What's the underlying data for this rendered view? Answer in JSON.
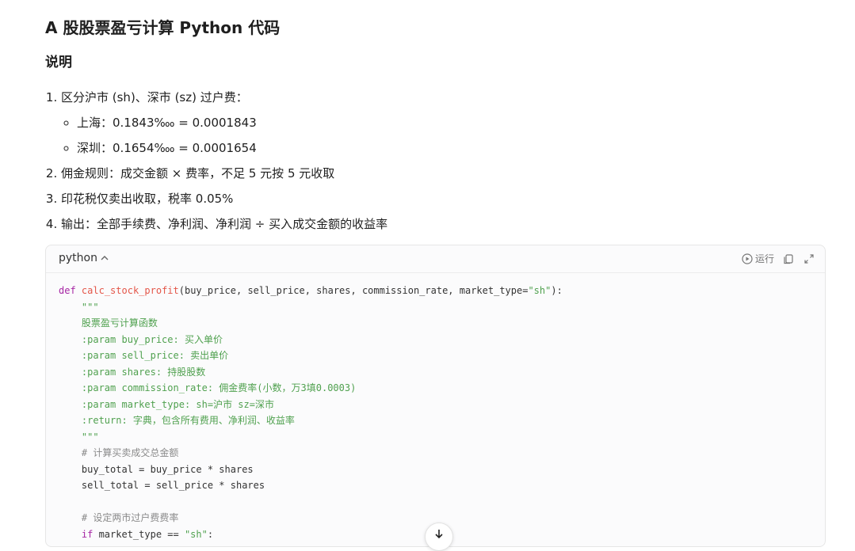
{
  "title": "A 股股票盈亏计算 Python 代码",
  "section_heading": "说明",
  "steps": [
    "区分沪市 (sh)、深市 (sz) 过户费：",
    "佣金规则：成交金额 × 费率，不足 5 元按 5 元收取",
    "印花税仅卖出收取，税率 0.05%",
    "输出：全部手续费、净利润、净利润 ÷ 买入成交金额的收益率"
  ],
  "substeps": [
    "上海：0.1843‱ = 0.0001843",
    "深圳：0.1654‱ = 0.0001654"
  ],
  "code_block": {
    "language": "python",
    "run_label": "运行",
    "icons": [
      "play-icon",
      "copy-icon",
      "expand-icon",
      "chevron-up-icon"
    ],
    "lines": {
      "l1_kw": "def",
      "l1_fn": "calc_stock_profit",
      "l1_args": "(buy_price, sell_price, shares, commission_rate, market_type=",
      "l1_str": "\"sh\"",
      "l1_end": "):",
      "doc_open": "    \"\"\"",
      "doc1": "    股票盈亏计算函数",
      "doc2": "    :param buy_price: 买入单价",
      "doc3": "    :param sell_price: 卖出单价",
      "doc4": "    :param shares: 持股股数",
      "doc5": "    :param commission_rate: 佣金费率(小数，万3填0.0003)",
      "doc6": "    :param market_type: sh=沪市 sz=深市",
      "doc7": "    :return: 字典，包含所有费用、净利润、收益率",
      "doc_close": "    \"\"\"",
      "cm1": "    # 计算买卖成交总金额",
      "c1": "    buy_total = buy_price * shares",
      "c2": "    sell_total = sell_price * shares",
      "blank": "",
      "cm2": "    # 设定两市过户费费率",
      "if_kw": "if",
      "if_rest": " market_type == ",
      "if_str": "\"sh\"",
      "if_end": ":"
    }
  }
}
